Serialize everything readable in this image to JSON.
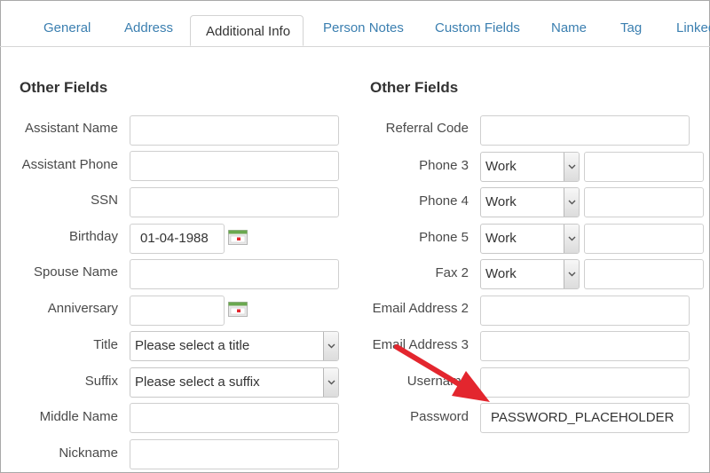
{
  "tabs": [
    "General",
    "Address",
    "Additional Info",
    "Person Notes",
    "Custom Fields",
    "Name",
    "Tag",
    "Linked"
  ],
  "left": {
    "title": "Other Fields",
    "assistant_name": "Assistant Name",
    "assistant_phone": "Assistant Phone",
    "ssn": "SSN",
    "birthday": "Birthday",
    "birthday_value": "01-04-1988",
    "spouse_name": "Spouse Name",
    "anniversary": "Anniversary",
    "title_label": "Title",
    "title_select": "Please select a title",
    "suffix_label": "Suffix",
    "suffix_select": "Please select a suffix",
    "middle_name": "Middle Name",
    "nickname": "Nickname"
  },
  "right": {
    "title": "Other Fields",
    "referral_code": "Referral Code",
    "phone3": "Phone 3",
    "phone4": "Phone 4",
    "phone5": "Phone 5",
    "fax2": "Fax 2",
    "work": "Work",
    "email2": "Email Address 2",
    "email3": "Email Address 3",
    "username": "Username",
    "password": "Password",
    "password_value": "PASSWORD_PLACEHOLDER"
  },
  "colors": {
    "tab_link": "#3b7fb0",
    "annotation_arrow": "#e3262e"
  },
  "icons": {
    "calendar": "calendar-icon",
    "dropdown": "chevron-down-icon"
  }
}
